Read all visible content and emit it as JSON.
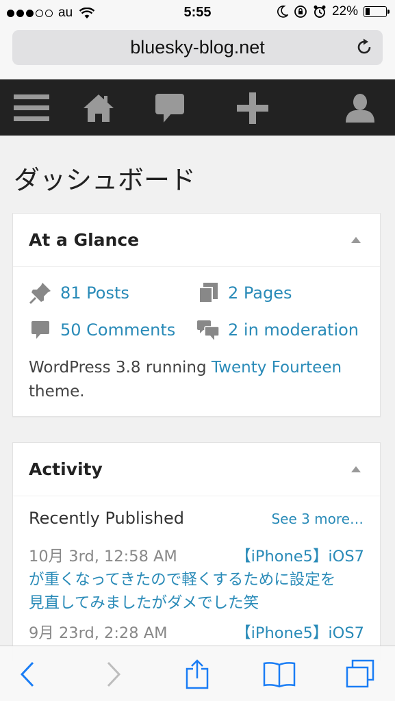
{
  "status_bar": {
    "carrier": "au",
    "time": "5:55",
    "battery_text": "22%",
    "battery_level": 0.22,
    "signal_bars_filled": 3,
    "signal_bars_total": 5
  },
  "browser": {
    "url": "bluesky-blog.net"
  },
  "admin_bar": {
    "icons": [
      "menu-icon",
      "home-icon",
      "comment-icon",
      "plus-icon",
      "user-icon"
    ]
  },
  "page": {
    "title": "ダッシュボード"
  },
  "at_a_glance": {
    "title": "At a Glance",
    "posts": "81 Posts",
    "pages": "2 Pages",
    "comments": "50 Comments",
    "moderation": "2 in moderation",
    "wp_prefix": "WordPress 3.8 running",
    "theme_link": "Twenty Fourteen",
    "wp_suffix": "theme."
  },
  "activity": {
    "title": "Activity",
    "recent_label": "Recently Published",
    "see_more": "See 3 more…",
    "items": [
      {
        "date": "10月 3rd, 12:58 AM",
        "title_start": "【iPhone5】iOS7",
        "title_line2": "が重くなってきたので軽くするために設定を",
        "title_line3": "見直してみましたがダメでした笑"
      },
      {
        "date": "9月 23rd, 2:28 AM",
        "title_start": "【iPhone5】iOS7"
      }
    ]
  },
  "colors": {
    "link": "#2a8bb8",
    "admin_bar": "#222222",
    "icon_gray": "#999999",
    "ios_blue": "#1a7df5"
  }
}
